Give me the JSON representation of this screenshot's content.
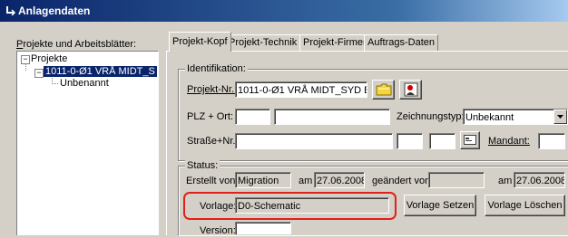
{
  "window": {
    "title": "Anlagendaten"
  },
  "tree": {
    "heading": "Projekte und Arbeitsblätter:",
    "root": "Projekte",
    "selected": "1011-0-Ø1 VRÅ MIDT_S",
    "child": "Unbenannt"
  },
  "tabs": [
    "Projekt-Kopf",
    "Projekt-Technik",
    "Projekt-Firmen",
    "Auftrags-Daten"
  ],
  "identifikation": {
    "legend": "Identifikation:",
    "projekt_label": "Projekt-Nr.:",
    "projekt_value": "1011-0-Ø1 VRÅ MIDT_SYD BY",
    "plz_label": "PLZ + Ort:",
    "zeichnungstyp_label": "Zeichnungstyp:",
    "zeichnungstyp_value": "Unbekannt",
    "strasse_label": "Straße+Nr.:",
    "mandant_label": "Mandant:"
  },
  "status": {
    "legend": "Status:",
    "erstellt_label": "Erstellt von:",
    "erstellt_value": "Migration",
    "am_label": "am",
    "erstellt_date": "27.06.2008",
    "geaendert_label": "geändert von:",
    "geaendert_value": "",
    "am2_label": "am",
    "geaendert_date": "27.06.2008",
    "vorlage_label": "Vorlage:",
    "vorlage_value": "D0-Schematic",
    "setzen_button": "Vorlage Setzen",
    "loeschen_button": "Vorlage Löschen",
    "version_label": "Version:"
  },
  "colors": {
    "highlight_outline": "#e0201a",
    "selection": "#0a246a"
  }
}
